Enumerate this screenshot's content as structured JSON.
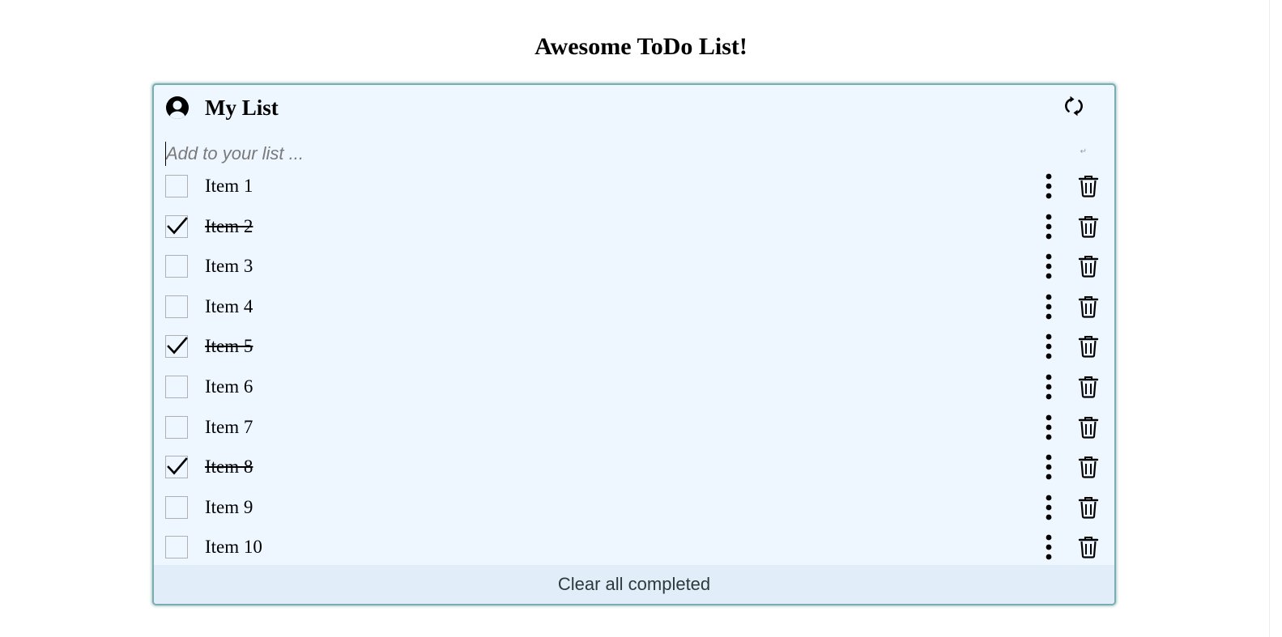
{
  "page": {
    "title": "Awesome ToDo List!"
  },
  "list": {
    "name": "My List",
    "add_placeholder": "Add to your list ...",
    "enter_hint": "↵",
    "items": [
      {
        "label": "Item 1",
        "completed": false
      },
      {
        "label": "Item 2",
        "completed": true
      },
      {
        "label": "Item 3",
        "completed": false
      },
      {
        "label": "Item 4",
        "completed": false
      },
      {
        "label": "Item 5",
        "completed": true
      },
      {
        "label": "Item 6",
        "completed": false
      },
      {
        "label": "Item 7",
        "completed": false
      },
      {
        "label": "Item 8",
        "completed": true
      },
      {
        "label": "Item 9",
        "completed": false
      },
      {
        "label": "Item 10",
        "completed": false
      }
    ],
    "clear_completed_label": "Clear all completed"
  },
  "icons": {
    "avatar": "user-circle-icon",
    "refresh": "refresh-icon",
    "more": "vertical-ellipsis-icon",
    "delete": "trash-icon",
    "check": "checkmark-icon"
  },
  "colors": {
    "card_background": "#eef6ff",
    "card_border": "#79adb0",
    "footer_background": "#e1edf8",
    "placeholder": "#7a7a7a"
  }
}
